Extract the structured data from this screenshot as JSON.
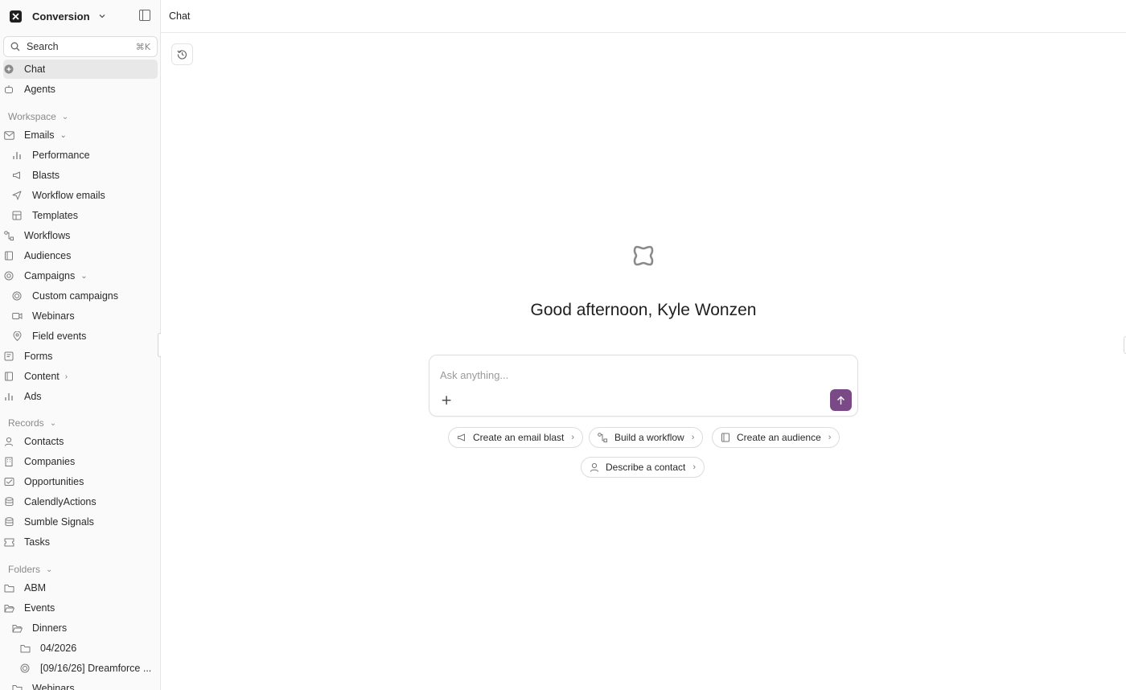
{
  "workspace": {
    "name": "Conversion"
  },
  "search": {
    "label": "Search",
    "shortcut": "⌘K"
  },
  "nav": {
    "chat": "Chat",
    "agents": "Agents",
    "workspace_section": "Workspace",
    "emails": "Emails",
    "performance": "Performance",
    "blasts": "Blasts",
    "workflow_emails": "Workflow emails",
    "templates": "Templates",
    "workflows": "Workflows",
    "audiences": "Audiences",
    "campaigns": "Campaigns",
    "custom_campaigns": "Custom campaigns",
    "webinars": "Webinars",
    "field_events": "Field events",
    "forms": "Forms",
    "content": "Content",
    "ads": "Ads",
    "records_section": "Records",
    "contacts": "Contacts",
    "companies": "Companies",
    "opportunities": "Opportunities",
    "calendly_actions": "CalendlyActions",
    "sumble_signals": "Sumble Signals",
    "tasks": "Tasks",
    "folders_section": "Folders",
    "abm": "ABM",
    "events": "Events",
    "dinners": "Dinners",
    "folder_0426": "04/2026",
    "dreamforce": "[09/16/26] Dreamforce ...",
    "webinars_folder": "Webinars"
  },
  "topbar": {
    "title": "Chat"
  },
  "main": {
    "greeting": "Good afternoon, Kyle Wonzen",
    "input_placeholder": "Ask anything...",
    "suggestions": {
      "email_blast": "Create an email blast",
      "workflow": "Build a workflow",
      "audience": "Create an audience",
      "contact": "Describe a contact"
    }
  },
  "colors": {
    "accent": "#7a4a86",
    "sidebar_bg": "#fafafa",
    "active_bg": "#e8e8e8"
  }
}
